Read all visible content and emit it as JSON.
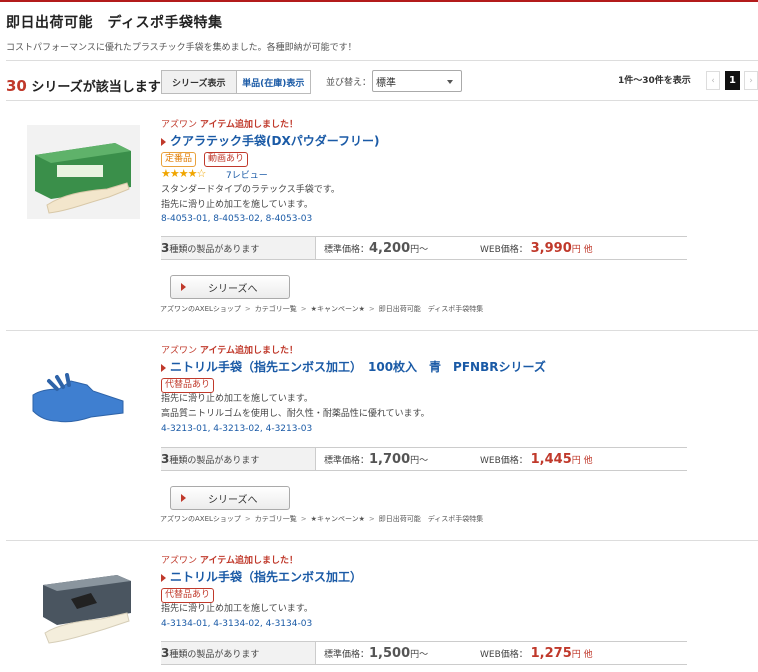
{
  "header": {
    "title": "即日出荷可能　ディスポ手袋特集",
    "subtitle": "コストパフォーマンスに優れたプラスチック手袋を集めました。各種即納が可能です！"
  },
  "toolbar": {
    "count_number": "30",
    "count_suffix": "シリーズが該当します",
    "view_series": "シリーズ表示",
    "view_single": "単品(在庫)表示",
    "sort_label": "並び替え：",
    "sort_value": "標準",
    "range_text": "1件～30件を表示",
    "page_prev": "‹",
    "page_current": "1",
    "page_next": "›"
  },
  "labels": {
    "maker": "アズワン",
    "added": "アイテム追加しました！",
    "std_price_label": "標準価格：",
    "web_price_label": "WEB価格：",
    "yen_suffix": "円～",
    "yen_web": "円",
    "web_tail": "他",
    "variants_suffix": "種類の製品があります",
    "series_button": "シリーズへ"
  },
  "items": [
    {
      "title": "クアラテック手袋(DXパウダーフリー)",
      "badges": [
        "定番品",
        "動画あり"
      ],
      "rating_stars": "★★★★☆",
      "rating": 4,
      "reviews": "7レビュー",
      "desc1": "スタンダードタイプのラテックス手袋です。",
      "desc2": "指先に滑り止め加工を施しています。",
      "codes": "8-4053-01, 8-4053-02, 8-4053-03",
      "variants": "3",
      "std_price": "4,200",
      "web_price": "3,990",
      "image": "glove-box-green",
      "colors": {
        "box": "#3a8f4a",
        "glove": "#f3e6cc"
      }
    },
    {
      "title": "ニトリル手袋（指先エンボス加工）　100枚入　青　PFNBRシリーズ",
      "badges": [
        "代替品あり"
      ],
      "desc1": "指先に滑り止め加工を施しています。",
      "desc2": "高品質ニトリルゴムを使用し、耐久性・耐薬品性に優れています。",
      "codes": "4-3213-01, 4-3213-02, 4-3213-03",
      "variants": "3",
      "std_price": "1,700",
      "web_price": "1,445",
      "image": "glove-blue",
      "colors": {
        "glove": "#3f7fd0"
      }
    },
    {
      "title": "ニトリル手袋（指先エンボス加工）",
      "badges": [
        "代替品あり"
      ],
      "desc1": "指先に滑り止め加工を施しています。",
      "codes": "4-3134-01, 4-3134-02, 4-3134-03",
      "variants": "3",
      "std_price": "1,500",
      "web_price": "1,275",
      "image": "glove-box-white",
      "colors": {
        "box": "#4a5560",
        "glove": "#f4eedc"
      }
    }
  ],
  "breadcrumb": [
    "アズワンのAXELショップ",
    "カテゴリ一覧",
    "★キャンペーン★",
    "即日出荷可能　ディスポ手袋特集"
  ],
  "breadcrumb_sep": ">",
  "colors": {
    "accent": "#c0392b",
    "link": "#1a5aa6",
    "topline": "#b31b1b"
  }
}
